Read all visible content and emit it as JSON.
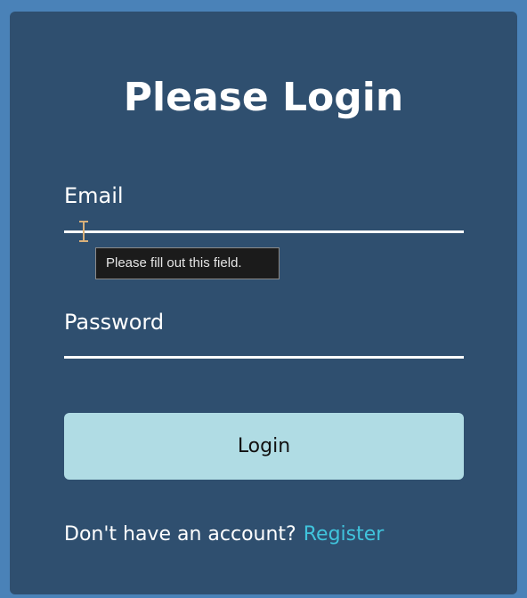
{
  "page": {
    "title": "Please Login"
  },
  "form": {
    "email": {
      "label": "Email",
      "value": "",
      "placeholder": ""
    },
    "password": {
      "label": "Password",
      "value": "",
      "placeholder": ""
    },
    "validation_tooltip": "Please fill out this field.",
    "submit_label": "Login"
  },
  "footer": {
    "prompt": "Don't have an account?",
    "register_label": "Register"
  },
  "colors": {
    "background": "#4a82b8",
    "card": "#2f4f6f",
    "button": "#b0dce4",
    "link": "#40c4dc"
  },
  "icons": {
    "cursor": "text-cursor-icon"
  }
}
